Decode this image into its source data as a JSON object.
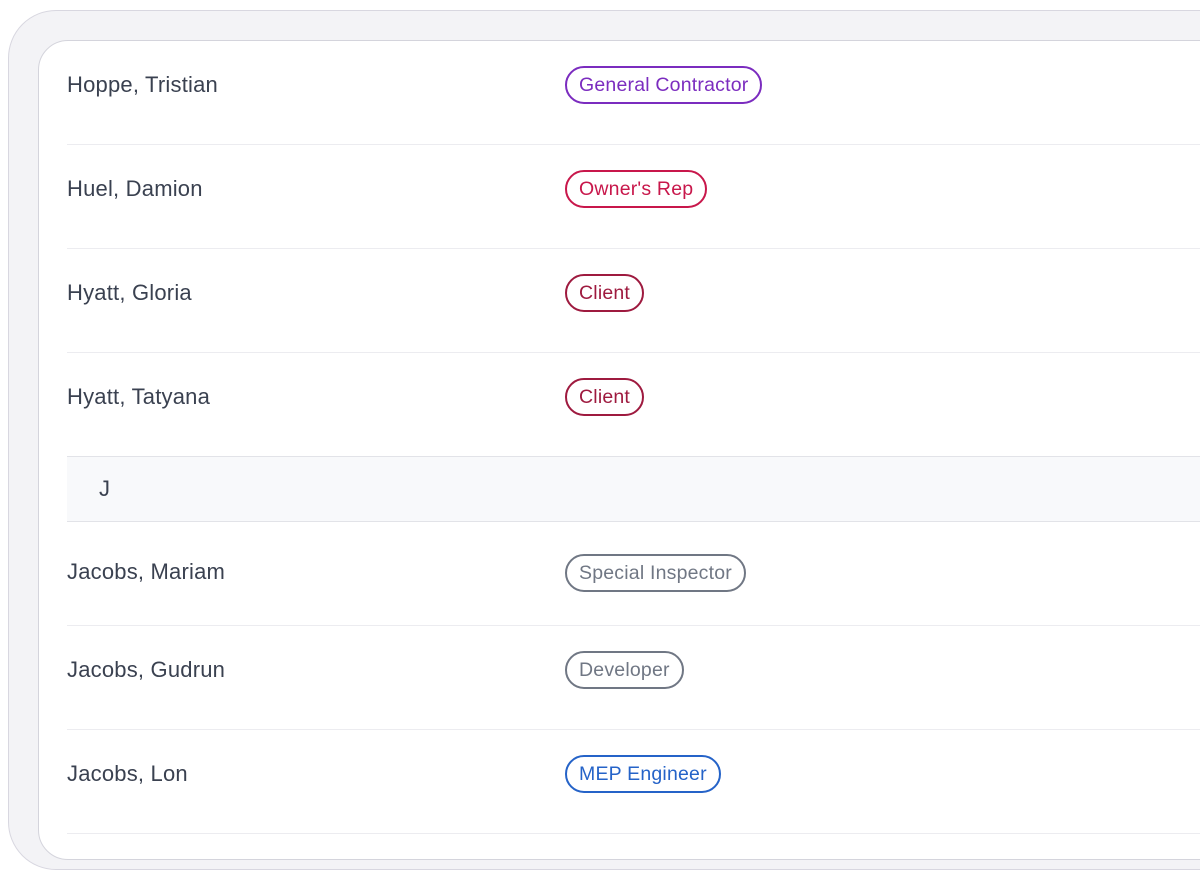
{
  "colors": {
    "purple": "#7b2cbf",
    "crimson": "#c8174b",
    "maroon": "#9e1a3f",
    "gray": "#707784",
    "blue": "#2563c8"
  },
  "groups_before": [
    {
      "name": "Hoppe, Tristian",
      "role": "General Contractor",
      "color": "#7b2cbf"
    },
    {
      "name": "Huel, Damion",
      "role": "Owner's Rep",
      "color": "#c8174b"
    },
    {
      "name": "Hyatt, Gloria",
      "role": "Client",
      "color": "#9e1a3f"
    },
    {
      "name": "Hyatt, Tatyana",
      "role": "Client",
      "color": "#9e1a3f"
    }
  ],
  "section_j": {
    "letter": "J"
  },
  "groups_after": [
    {
      "name": "Jacobs, Mariam",
      "role": "Special Inspector",
      "color": "#707784"
    },
    {
      "name": "Jacobs, Gudrun",
      "role": "Developer",
      "color": "#707784"
    },
    {
      "name": "Jacobs, Lon",
      "role": "MEP Engineer",
      "color": "#2563c8"
    }
  ]
}
